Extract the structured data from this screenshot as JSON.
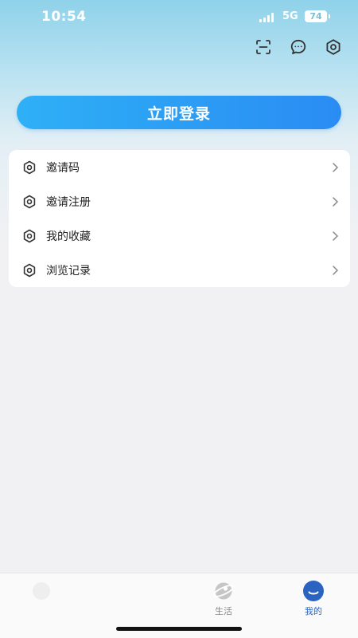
{
  "status_bar": {
    "time": "10:54",
    "network": "5G",
    "battery": "74"
  },
  "top_icons": {
    "scan": "scan-icon",
    "message": "message-icon",
    "settings": "settings-icon"
  },
  "login_button": {
    "label": "立即登录",
    "color": "#2a8cf3"
  },
  "menu": {
    "items": [
      {
        "label": "邀请码",
        "icon": "hexagon-gear-icon"
      },
      {
        "label": "邀请注册",
        "icon": "hexagon-gear-icon"
      },
      {
        "label": "我的收藏",
        "icon": "hexagon-gear-icon"
      },
      {
        "label": "浏览记录",
        "icon": "hexagon-gear-icon"
      }
    ]
  },
  "bottom_nav": {
    "items": [
      {
        "label": "生活",
        "icon": "planet-icon",
        "active": false
      },
      {
        "label": "我的",
        "icon": "smile-icon",
        "active": true
      }
    ],
    "active_color": "#2b64c0"
  }
}
